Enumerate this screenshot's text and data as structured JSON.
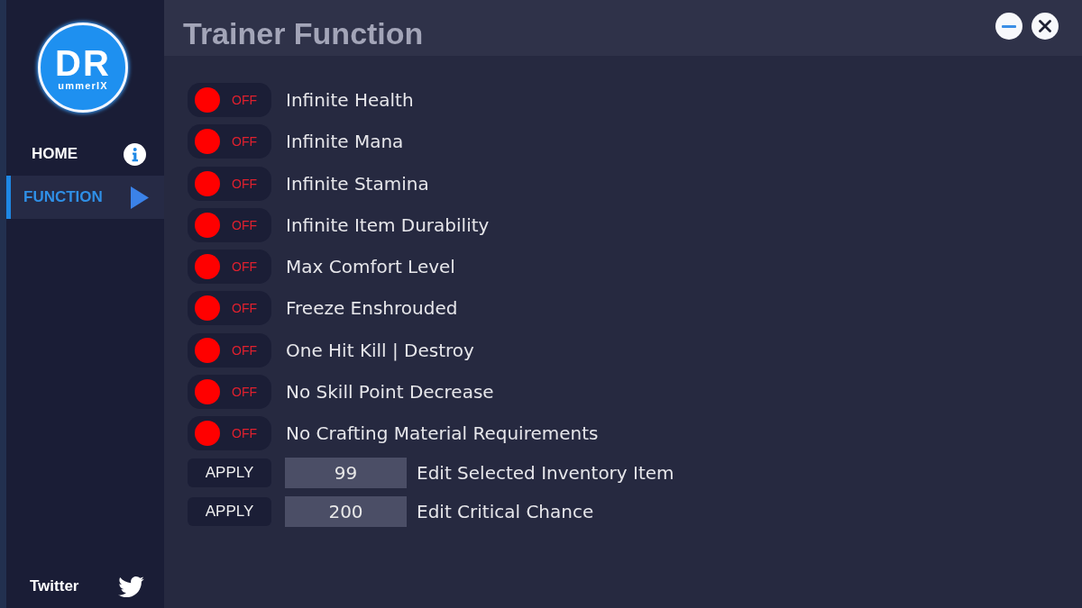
{
  "logo": {
    "initials": "DR",
    "subtitle": "ummerIX"
  },
  "nav": [
    {
      "label": "HOME",
      "kind": "info",
      "selected": false
    },
    {
      "label": "FUNCTION",
      "kind": "play",
      "selected": true
    }
  ],
  "footer_link": {
    "label": "Twitter"
  },
  "title": "Trainer Function",
  "window_controls": [
    {
      "kind": "minimize"
    },
    {
      "kind": "close"
    }
  ],
  "toggles": [
    {
      "label": "Infinite Health",
      "on": false,
      "state_label": "OFF"
    },
    {
      "label": "Infinite Mana",
      "on": false,
      "state_label": "OFF"
    },
    {
      "label": "Infinite Stamina",
      "on": false,
      "state_label": "OFF"
    },
    {
      "label": "Infinite Item Durability",
      "on": false,
      "state_label": "OFF"
    },
    {
      "label": "Max Comfort Level",
      "on": false,
      "state_label": "OFF"
    },
    {
      "label": "Freeze Enshrouded",
      "on": false,
      "state_label": "OFF"
    },
    {
      "label": "One Hit Kill | Destroy",
      "on": false,
      "state_label": "OFF"
    },
    {
      "label": "No Skill Point Decrease",
      "on": false,
      "state_label": "OFF"
    },
    {
      "label": "No Crafting Material Requirements",
      "on": false,
      "state_label": "OFF"
    }
  ],
  "value_edits": [
    {
      "button": "APPLY",
      "value": "99",
      "label": "Edit Selected Inventory Item"
    },
    {
      "button": "APPLY",
      "value": "200",
      "label": "Edit Critical Chance"
    }
  ]
}
